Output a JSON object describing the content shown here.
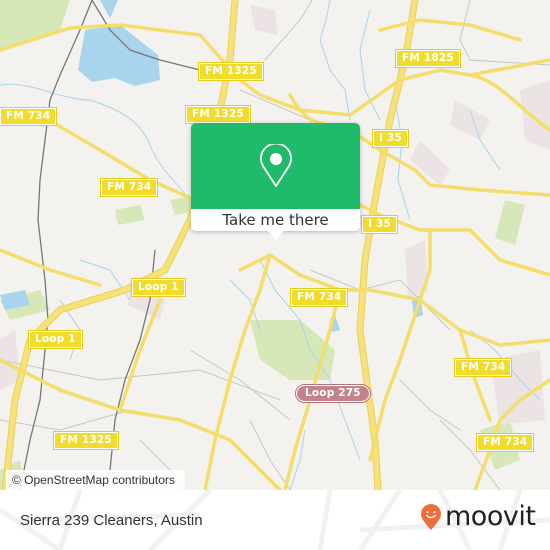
{
  "map": {
    "road_labels": [
      {
        "text": "FM 1325",
        "kind": "highway"
      },
      {
        "text": "FM 1825",
        "kind": "highway"
      },
      {
        "text": "FM 734",
        "kind": "highway"
      },
      {
        "text": "FM 1325",
        "kind": "highway"
      },
      {
        "text": "I 35",
        "kind": "highway"
      },
      {
        "text": "FM 734",
        "kind": "highway"
      },
      {
        "text": "I 35",
        "kind": "highway"
      },
      {
        "text": "Loop 1",
        "kind": "highway"
      },
      {
        "text": "FM 734",
        "kind": "highway"
      },
      {
        "text": "Loop 1",
        "kind": "highway"
      },
      {
        "text": "FM 734",
        "kind": "highway"
      },
      {
        "text": "Loop 275",
        "kind": "loop"
      },
      {
        "text": "FM 1325",
        "kind": "highway"
      },
      {
        "text": "FM 734",
        "kind": "highway"
      }
    ],
    "attribution": "© OpenStreetMap contributors",
    "colors": {
      "background": "#f3f2ee",
      "road": "#f7e27a",
      "water": "#a8d4ee",
      "park": "#d7e8b8",
      "shield": "#f2dc2b",
      "loop_shield": "#c4838b"
    }
  },
  "popup": {
    "icon": "map-pin-icon",
    "button_label": "Take me there",
    "accent": "#1fba6a"
  },
  "footer": {
    "place_name": "Sierra 239 Cleaners, Austin",
    "brand": "moovit",
    "brand_color": "#f26b3a"
  }
}
